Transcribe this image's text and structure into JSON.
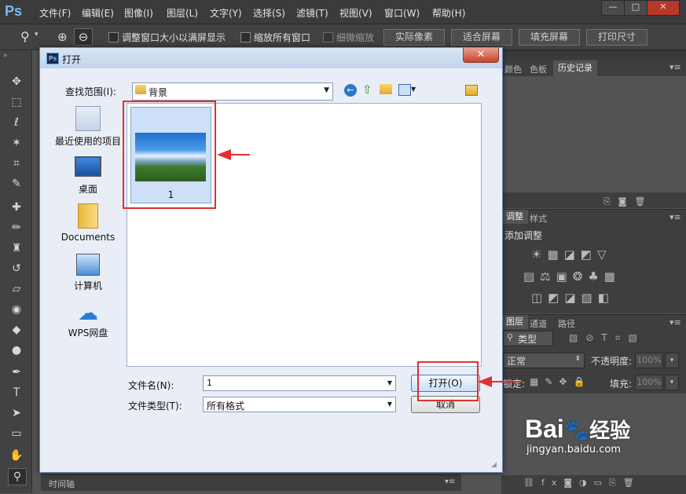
{
  "app": {
    "logo": "Ps",
    "menus": [
      "文件(F)",
      "编辑(E)",
      "图像(I)",
      "图层(L)",
      "文字(Y)",
      "选择(S)",
      "滤镜(T)",
      "视图(V)",
      "窗口(W)",
      "帮助(H)"
    ],
    "window_controls": {
      "minimize": "—",
      "maximize": "□",
      "close": "✕"
    }
  },
  "options_bar": {
    "check1": "调整窗口大小以满屏显示",
    "check2": "缩放所有窗口",
    "check3": "细微缩放",
    "btn_actual": "实际像素",
    "btn_fit": "适合屏幕",
    "btn_fill": "填充屏幕",
    "btn_print": "打印尺寸"
  },
  "panels": {
    "top_tabs": [
      "颜色",
      "色板",
      "历史记录"
    ],
    "adjust_tabs": [
      "调整",
      "样式"
    ],
    "adjust_title": "添加调整",
    "layers_tabs": [
      "图层",
      "通道",
      "路径"
    ],
    "kind_label": "类型",
    "blend_mode": "正常",
    "opacity_label": "不透明度:",
    "opacity_value": "100%",
    "lock_label": "锁定:",
    "fill_label": "填充:",
    "fill_value": "100%"
  },
  "timeline": {
    "label": "时间轴"
  },
  "dialog": {
    "title": "打开",
    "close_glyph": "✕",
    "lookin_label": "查找范围(I):",
    "lookin_value": "背景",
    "places": [
      {
        "label": "最近使用的项目"
      },
      {
        "label": "桌面"
      },
      {
        "label": "Documents"
      },
      {
        "label": "计算机"
      },
      {
        "label": "WPS网盘"
      }
    ],
    "file_item_name": "1",
    "filename_label": "文件名(N):",
    "filename_value": "1",
    "filetype_label": "文件类型(T):",
    "filetype_value": "所有格式",
    "open_button": "打开(O)",
    "cancel_button": "取消"
  },
  "watermark": {
    "brand": "Bai",
    "brand_cn": "经验",
    "url": "jingyan.baidu.com"
  },
  "colors": {
    "annotation_red": "#e03030",
    "ps_dark": "#535353",
    "dialog_bg": "#e9eef6"
  }
}
